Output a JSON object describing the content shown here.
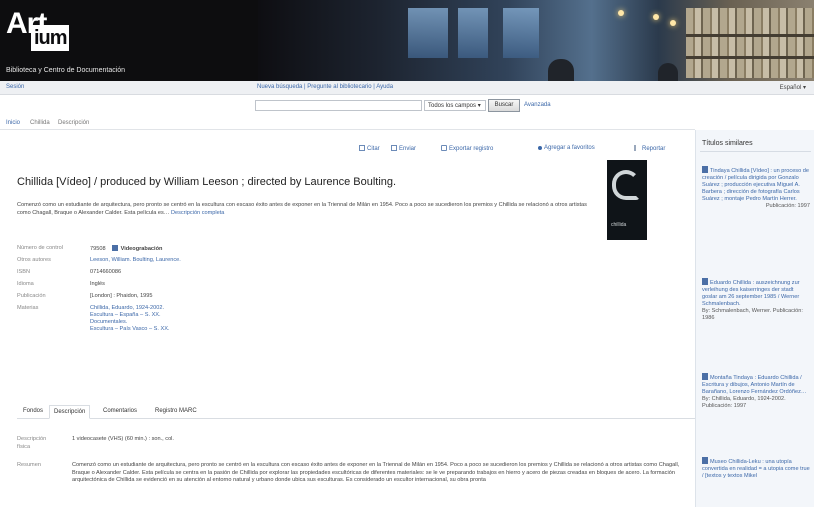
{
  "header": {
    "logo_top": "Art",
    "logo_box": "ium",
    "subtitle": "Biblioteca y Centro de Documentación"
  },
  "topnav": {
    "left": "Sesión",
    "center": "Nueva búsqueda | Pregunte al bibliotecario | Ayuda",
    "right": "Español ▾"
  },
  "search": {
    "field_value": "",
    "scope": "Todos los campos",
    "button": "Buscar",
    "advanced": "Avanzada"
  },
  "breadcrumb": {
    "home": "Inicio",
    "item": "Chillida",
    "current": "Descripción"
  },
  "toolbar": {
    "cite": "Citar",
    "email": "Enviar",
    "export": "Exportar registro",
    "favorites": "Agregar a favoritos",
    "report": "Reportar"
  },
  "record": {
    "title": "Chillida [Vídeo] / produced by William Leeson ; directed by Laurence Boulting.",
    "summary": "Comenzó como un estudiante de arquitectura, pero pronto se centró en la escultura con escaso éxito antes de exponer en la Triennal de Milán en 1954. Poco a poco se sucedieron los premios y Chillida se relacionó a otros artistas como Chagall, Braque o Alexander Calder. Esta película es…",
    "summary_more": "Descripción completa",
    "cover_text": "chillida",
    "fields": [
      {
        "label": "Número de control",
        "value": "79508",
        "format": "Videograbación",
        "link": false
      },
      {
        "label": "Otros autores",
        "value": "Leeson, William. Boulting, Laurence.",
        "link": true
      },
      {
        "label": "ISBN",
        "value": "0714660086",
        "link": false
      },
      {
        "label": "Idioma",
        "value": "Inglés",
        "link": false
      },
      {
        "label": "Publicación",
        "value": "[London] : Phaidon, 1995",
        "link": false
      }
    ],
    "subjects_label": "Materias",
    "subjects": [
      "Chillida, Eduardo, 1924-2002.",
      "Escultura – España – S. XX.",
      "Documentales.",
      "Escultura – País Vasco – S. XX."
    ]
  },
  "tabs": [
    "Fondos",
    "Descripción",
    "Comentarios",
    "Registro MARC"
  ],
  "description": {
    "physical_label": "Descripción física",
    "physical_value": "1 videocasete (VHS) (60 min.) : son., col.",
    "summary_label": "Resumen",
    "summary_value": "Comenzó como un estudiante de arquitectura, pero pronto se centró en la escultura con escaso éxito antes de exponer en la Triennal de Milán en 1954. Poco a poco se sucedieron los premios y Chillida se relacionó a otros artistas como Chagall, Braque o Alexander Calder. Esta película se centra en la pasión de Chillida por explorar las propiedades escultóricas de diferentes materiales: se le ve preparando trabajos en hierro y acero de piezas creadas en bloques de acero. La formación arquitectónica de Chillida se evidenció en su atención al entorno natural y urbano donde ubica sus esculturas. Es considerado un escultor internacional, su obra pronta"
  },
  "sidebar": {
    "title": "Títulos similares",
    "items": [
      {
        "title": "Tindaya Chillida [Vídeo] : un proceso de creación / película dirigida por Gonzalo Suárez ; producción ejecutiva Miguel A. Barbera ; dirección de fotografía Carlos Suárez ; montaje Pedro Martín Herrer.",
        "meta": "Publicación: 1997"
      },
      {
        "title": "Eduardo Chillida : auszeichnung zur verleihung des kaiserringes der stadt goslar am 26 september 1985 / Werner Schmalenbach.",
        "meta": "By: Schmalenbach, Werner. Publicación: 1986"
      },
      {
        "title": "Montaña Tindaya : Eduardo Chillida / Escritura y dibujos, Antonio Martín de Barañano, Lorenzo Fernández Ordóñez…",
        "meta": "By: Chillida, Eduardo, 1924-2002. Publicación: 1997"
      },
      {
        "title": "Museo Chillida-Leku : una utopía convertida en realidad = a utopia come true / [textos y textos Mikel",
        "meta": ""
      }
    ]
  }
}
